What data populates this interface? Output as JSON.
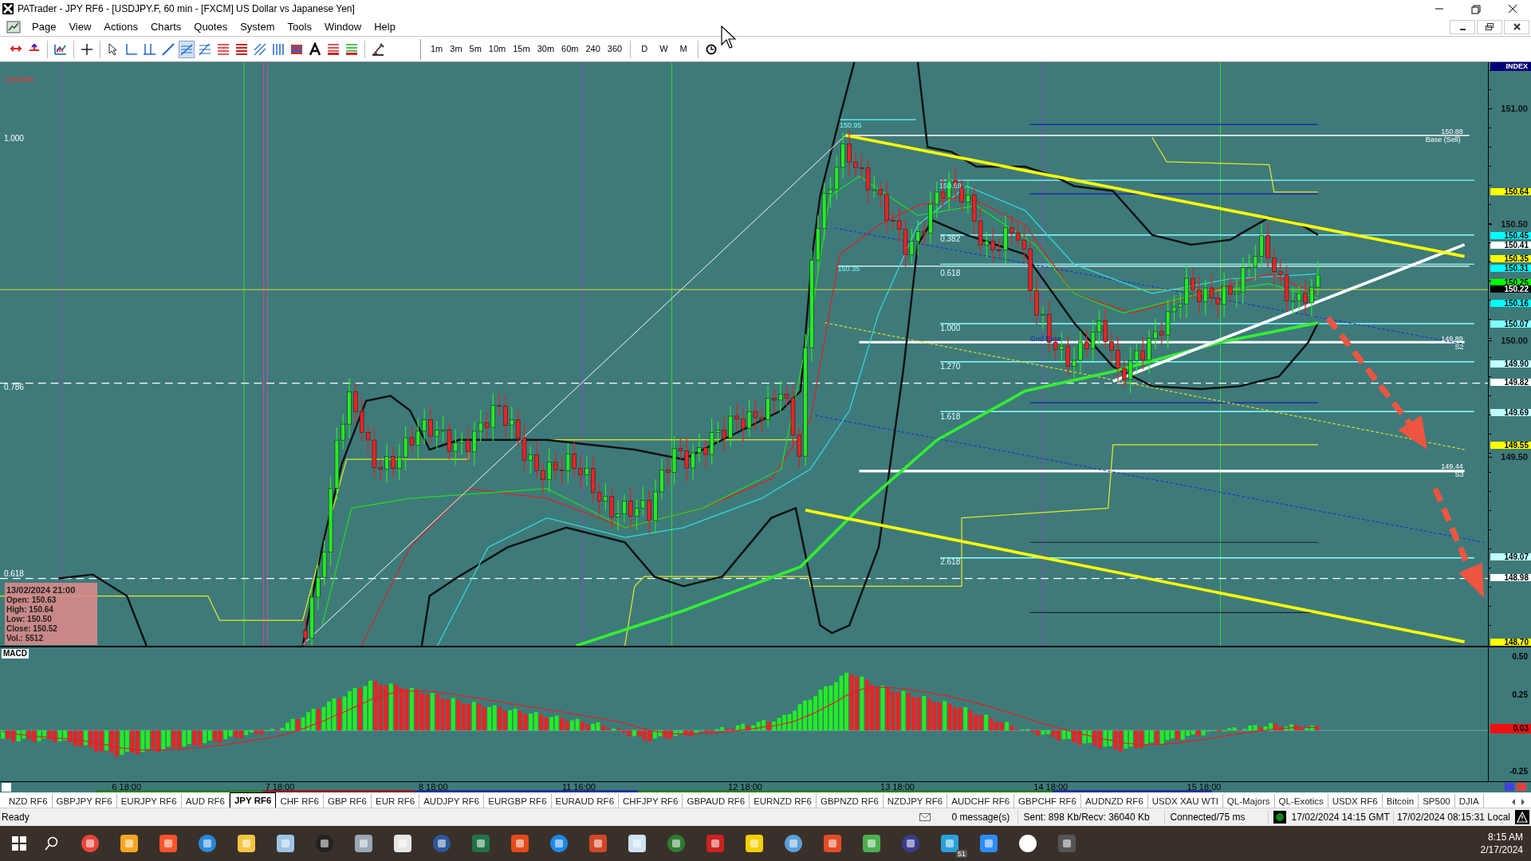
{
  "window": {
    "title": "PATrader - JPY RF6 - [USDJPY.F, 60 min - [FXCM] US Dollar vs Japanese Yen]"
  },
  "menu": [
    "Page",
    "View",
    "Actions",
    "Charts",
    "Quotes",
    "System",
    "Tools",
    "Window",
    "Help"
  ],
  "toolbar": {
    "timeframes": [
      "1m",
      "3m",
      "5m",
      "10m",
      "15m",
      "30m",
      "60m",
      "240",
      "360"
    ],
    "periods": [
      "D",
      "W",
      "M"
    ]
  },
  "chart": {
    "status": "Locked",
    "index_label": "INDEX",
    "left_levels": [
      "1.000",
      "0.786",
      "0.618"
    ],
    "fib_levels": [
      "0.382",
      "0.618",
      "1.000",
      "1.270",
      "1.618",
      "2.618"
    ],
    "annotations": [
      "150.95",
      "150.69",
      "150.35",
      "Grid Base",
      "150.88",
      "Base (Sell)",
      "149.89",
      "S2",
      "149.44",
      "S3"
    ],
    "price_axis": [
      {
        "text": "151.00",
        "kind": "tick"
      },
      {
        "text": "150.64",
        "kind": "badge",
        "color": "#ffff00"
      },
      {
        "text": "150.50",
        "kind": "tick"
      },
      {
        "text": "150.45",
        "kind": "badge",
        "color": "#00ffff"
      },
      {
        "text": "150.41",
        "kind": "badge",
        "color": "#ffffff"
      },
      {
        "text": "150.35",
        "kind": "badge",
        "color": "#ffff00"
      },
      {
        "text": "150.31",
        "kind": "badge",
        "color": "#00ffff"
      },
      {
        "text": "150.25",
        "kind": "badge",
        "color": "#00ff00"
      },
      {
        "text": "150.22",
        "kind": "badge",
        "color": "#000000"
      },
      {
        "text": "150.16",
        "kind": "badge",
        "color": "#00ffff"
      },
      {
        "text": "150.07",
        "kind": "badge",
        "color": "#80ffff"
      },
      {
        "text": "150.00",
        "kind": "tick"
      },
      {
        "text": "149.90",
        "kind": "badge",
        "color": "#c0ffff"
      },
      {
        "text": "149.82",
        "kind": "badge",
        "color": "#ffffff"
      },
      {
        "text": "149.69",
        "kind": "badge",
        "color": "#c0ffff"
      },
      {
        "text": "149.55",
        "kind": "badge",
        "color": "#ffff00"
      },
      {
        "text": "149.50",
        "kind": "tick"
      },
      {
        "text": "149.07",
        "kind": "badge",
        "color": "#c0ffff"
      },
      {
        "text": "148.98",
        "kind": "badge",
        "color": "#ffffff"
      },
      {
        "text": "148.70",
        "kind": "badge",
        "color": "#ffff00"
      }
    ],
    "info_box": {
      "date": "13/02/2024 21:00",
      "lines": [
        "Open: 150.63",
        "High: 150.64",
        "Low: 150.50",
        "Close: 150.52",
        "Vol.: 5512"
      ]
    },
    "date_axis": [
      "6 18:00",
      "7 18:00",
      "8 18:00",
      "11 16:00",
      "12 18:00",
      "13 18:00",
      "14 18:00",
      "15 18:00"
    ]
  },
  "macd": {
    "label": "MACD",
    "axis": [
      "0.50",
      "0.25",
      "-0.25"
    ],
    "value_badge": "0.03"
  },
  "tabs": [
    {
      "label": "NZD RF6",
      "selected": false
    },
    {
      "label": "GBPJPY RF6",
      "selected": false
    },
    {
      "label": "EURJPY RF6",
      "selected": false
    },
    {
      "label": "AUD RF6",
      "selected": false
    },
    {
      "label": "JPY RF6",
      "selected": true
    },
    {
      "label": "CHF RF6",
      "selected": false
    },
    {
      "label": "GBP RF6",
      "selected": false
    },
    {
      "label": "EUR RF6",
      "selected": false
    },
    {
      "label": "AUDJPY RF6",
      "selected": false
    },
    {
      "label": "EURGBP RF6",
      "selected": false
    },
    {
      "label": "EURAUD RF6",
      "selected": false
    },
    {
      "label": "CHFJPY RF6",
      "selected": false
    },
    {
      "label": "GBPAUD RF6",
      "selected": false
    },
    {
      "label": "EURNZD RF6",
      "selected": false
    },
    {
      "label": "GBPNZD RF6",
      "selected": false
    },
    {
      "label": "NZDJPY RF6",
      "selected": false
    },
    {
      "label": "AUDCHF RF6",
      "selected": false
    },
    {
      "label": "GBPCHF RF6",
      "selected": false
    },
    {
      "label": "AUDNZD RF6",
      "selected": false
    },
    {
      "label": "USDX XAU WTI",
      "selected": false
    },
    {
      "label": "QL-Majors",
      "selected": false
    },
    {
      "label": "QL-Exotics",
      "selected": false
    },
    {
      "label": "USDX RF6",
      "selected": false
    },
    {
      "label": "Bitcoin",
      "selected": false
    },
    {
      "label": "SP500",
      "selected": false
    },
    {
      "label": "DJIA",
      "selected": false
    }
  ],
  "status_bar": {
    "state": "Ready",
    "messages": "0 message(s)",
    "traffic": "Sent: 898 Kb/Recv: 36040 Kb",
    "connection": "Connected/75 ms",
    "gmt_time": "17/02/2024 14:15 GMT",
    "local_time": "17/02/2024 08:15:31 Local"
  },
  "taskbar": {
    "badge": "51",
    "time": "8:15 AM",
    "date": "2/17/2024"
  }
}
